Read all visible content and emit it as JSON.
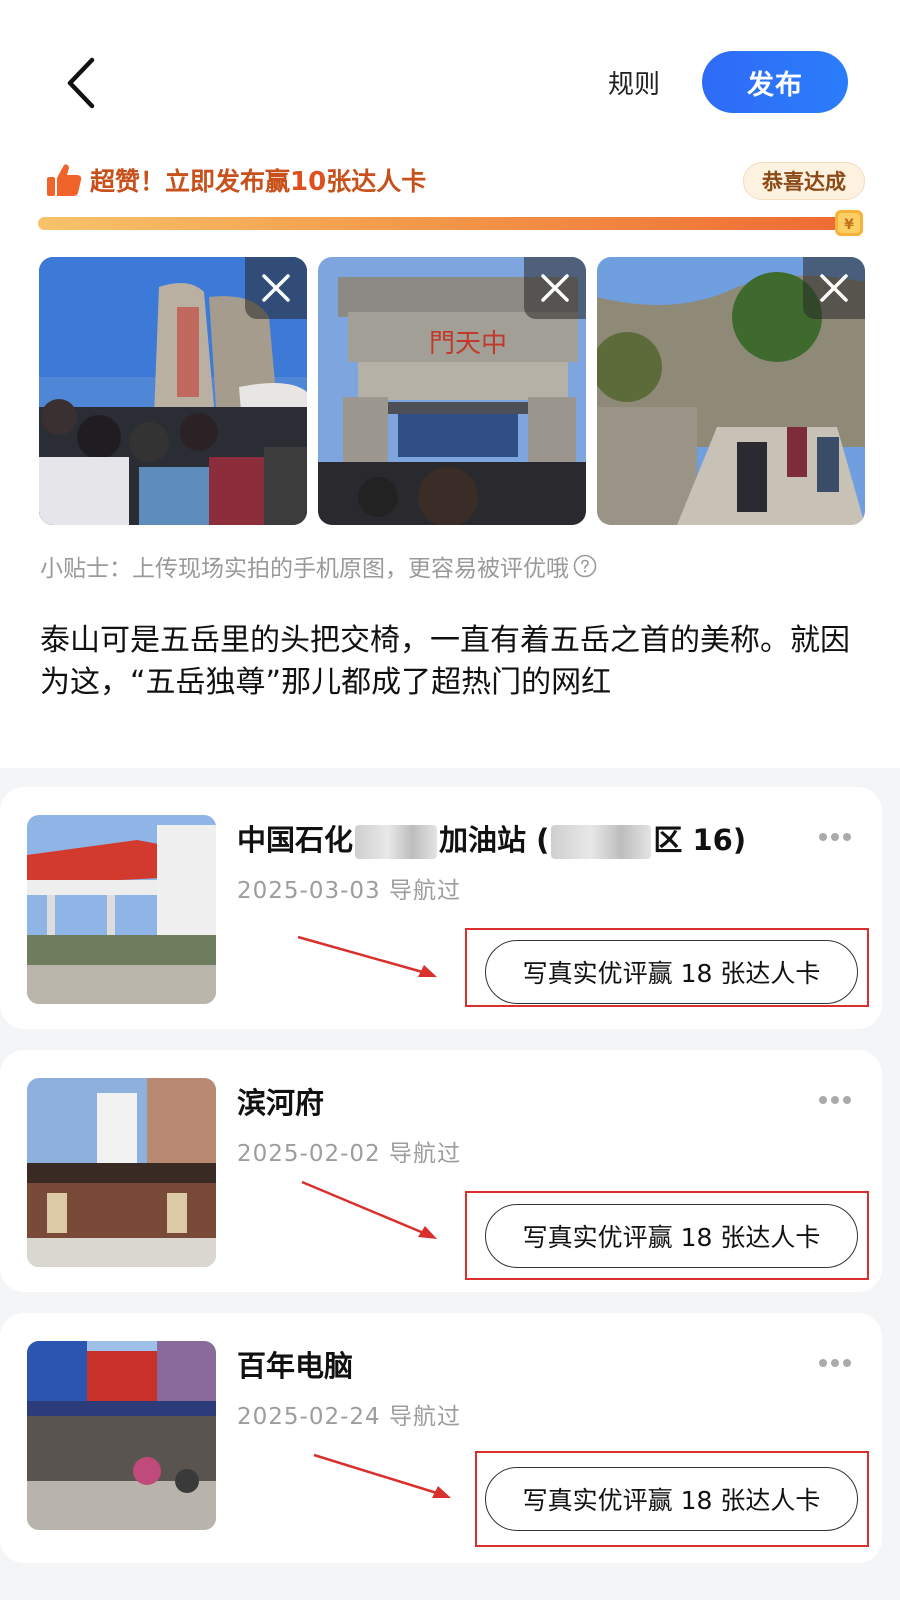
{
  "header": {
    "rules_label": "规则",
    "publish_label": "发布"
  },
  "promo": {
    "prefix": "超赞！立即发布赢",
    "count": "10",
    "suffix": "张达人卡",
    "badge": "恭喜达成",
    "progress": 1.0,
    "coin_symbol": "¥"
  },
  "tip": "小贴士：上传现场实拍的手机原图，更容易被评优哦",
  "content": "泰山可是五岳里的头把交椅，一直有着五岳之首的美称。就因为这，“五岳独尊”那儿都成了超热门的网红",
  "places": [
    {
      "title_a": "中国石化",
      "title_b": "加油站 (",
      "title_c": "区 16)",
      "date": "2025-03-03  导航过",
      "cta": "写真实优评赢 18 张达人卡"
    },
    {
      "title": "滨河府",
      "date": "2025-02-02 导航过",
      "cta": "写真实优评赢 18 张达人卡"
    },
    {
      "title": "百年电脑",
      "date": "2025-02-24 导航过",
      "cta": "写真实优评赢 18 张达人卡"
    }
  ],
  "colors": {
    "accent": "#2f6bf6",
    "promo": "#c8511b",
    "highlight": "#d9302e"
  }
}
